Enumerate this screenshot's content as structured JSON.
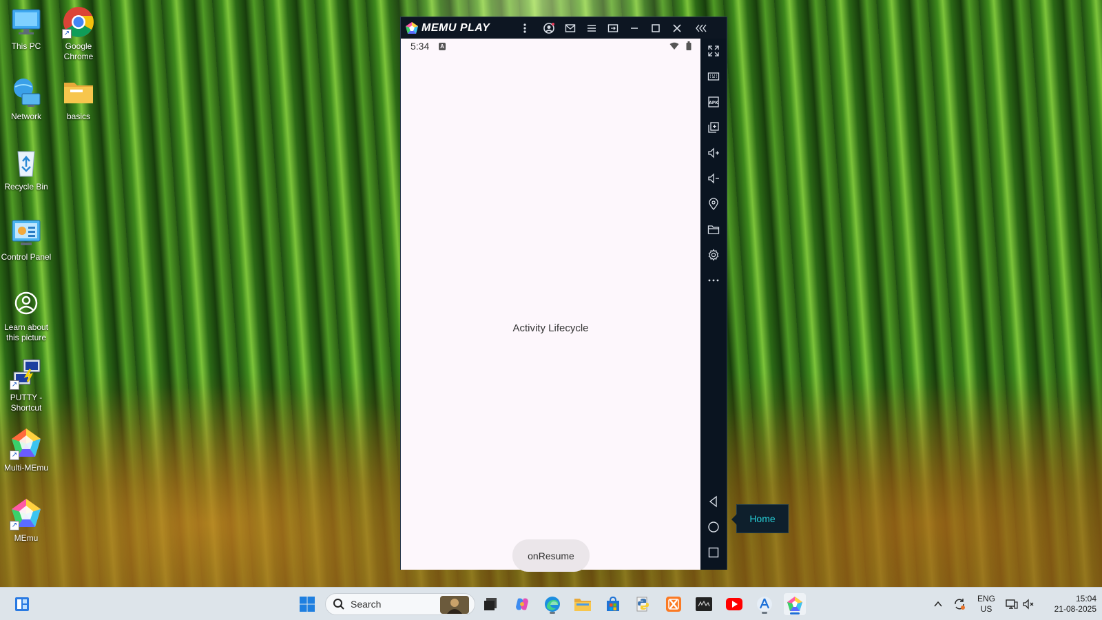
{
  "desktop": {
    "icons": [
      {
        "label": "This PC"
      },
      {
        "label": "Google Chrome"
      },
      {
        "label": "Network"
      },
      {
        "label": "basics"
      },
      {
        "label": "Recycle Bin"
      },
      {
        "label": "Control Panel"
      },
      {
        "label": "Learn about this picture"
      },
      {
        "label": "PUTTY - Shortcut"
      },
      {
        "label": "Multi-MEmu"
      },
      {
        "label": "MEmu"
      }
    ]
  },
  "emulator": {
    "title": "MEMU PLAY",
    "status_time": "5:34",
    "status_badge": "A",
    "app_text": "Activity Lifecycle",
    "button_label": "onResume",
    "tooltip": "Home",
    "apk_label": "APK"
  },
  "taskbar": {
    "search_placeholder": "Search",
    "language": "ENG",
    "region": "US",
    "time": "15:04",
    "date": "21-08-2025"
  },
  "colors": {
    "emulator_dark": "#0c1a2b",
    "screen_bg": "#fdf7fc",
    "tooltip_text": "#27d0d8",
    "taskbar_bg": "#dde4ea"
  }
}
